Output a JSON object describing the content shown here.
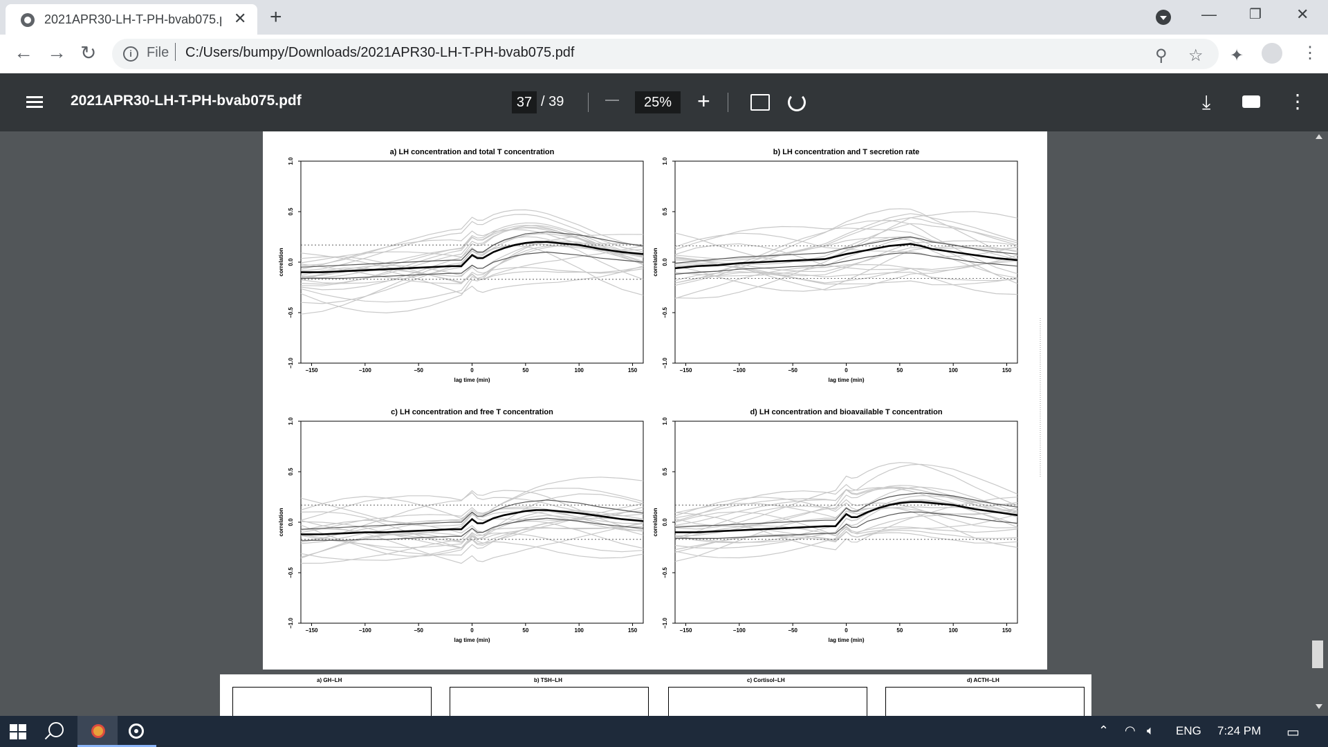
{
  "browser": {
    "tab_title": "2021APR30-LH-T-PH-bvab075.pdf",
    "new_tab": "+",
    "address_scheme": "File",
    "address_url": "C:/Users/bumpy/Downloads/2021APR30-LH-T-PH-bvab075.pdf"
  },
  "viewer": {
    "file_title": "2021APR30-LH-T-PH-bvab075.pdf",
    "current_page": "37",
    "total_pages": "/ 39",
    "zoom": "25%"
  },
  "taskbar": {
    "language": "ENG",
    "time": "7:24 PM"
  },
  "page38_titles": [
    "a) GH–LH",
    "b) TSH–LH",
    "c) Cortisol–LH",
    "d) ACTH–LH"
  ],
  "colors": {
    "thin_lines": "#c8c8c8",
    "mean_line": "#000000",
    "band_line": "#555555",
    "viewer_bg": "#525659",
    "toolbar_bg": "#323639"
  },
  "chart_data": [
    {
      "type": "line",
      "title": "a) LH concentration and total T concentration",
      "xlabel": "lag time (min)",
      "ylabel": "correlation",
      "x_ticks": [
        "−150",
        "−100",
        "−50",
        "0",
        "50",
        "100",
        "150"
      ],
      "y_ticks": [
        "−1.0",
        "−0.5",
        "0.0",
        "0.5",
        "1.0"
      ],
      "xlim": [
        -160,
        160
      ],
      "ylim": [
        -1,
        1
      ],
      "x": [
        -160,
        -140,
        -120,
        -100,
        -80,
        -60,
        -40,
        -20,
        -10,
        0,
        5,
        10,
        20,
        30,
        40,
        50,
        60,
        70,
        80,
        100,
        120,
        140,
        160
      ],
      "series": [
        {
          "role": "mean",
          "values": [
            -0.1,
            -0.1,
            -0.09,
            -0.08,
            -0.07,
            -0.06,
            -0.05,
            -0.04,
            -0.04,
            0.07,
            0.04,
            0.04,
            0.1,
            0.14,
            0.17,
            0.19,
            0.2,
            0.2,
            0.19,
            0.17,
            0.13,
            0.1,
            0.08
          ]
        },
        {
          "role": "band_low",
          "values": [
            -0.16,
            -0.16,
            -0.16,
            -0.15,
            -0.14,
            -0.13,
            -0.12,
            -0.11,
            -0.11,
            -0.03,
            -0.06,
            -0.06,
            0.0,
            0.03,
            0.06,
            0.08,
            0.09,
            0.1,
            0.09,
            0.07,
            0.04,
            0.02,
            0.0
          ]
        },
        {
          "role": "band_high",
          "values": [
            -0.05,
            -0.04,
            -0.03,
            -0.02,
            -0.01,
            0.0,
            0.01,
            0.02,
            0.02,
            0.13,
            0.1,
            0.1,
            0.17,
            0.22,
            0.25,
            0.28,
            0.29,
            0.3,
            0.29,
            0.27,
            0.23,
            0.19,
            0.16
          ]
        }
      ],
      "significance": [
        0.17,
        -0.17
      ]
    },
    {
      "type": "line",
      "title": "b) LH concentration and T secretion rate",
      "xlabel": "lag time (min)",
      "ylabel": "correlation",
      "x_ticks": [
        "−150",
        "−100",
        "−50",
        "0",
        "50",
        "100",
        "150"
      ],
      "y_ticks": [
        "−1.0",
        "−0.5",
        "0.0",
        "0.5",
        "1.0"
      ],
      "xlim": [
        -160,
        160
      ],
      "ylim": [
        -1,
        1
      ],
      "x": [
        -160,
        -140,
        -120,
        -100,
        -80,
        -60,
        -40,
        -20,
        0,
        20,
        40,
        50,
        60,
        70,
        80,
        100,
        120,
        140,
        160
      ],
      "series": [
        {
          "role": "mean",
          "values": [
            -0.06,
            -0.04,
            -0.03,
            -0.01,
            0.0,
            0.01,
            0.02,
            0.03,
            0.08,
            0.12,
            0.16,
            0.17,
            0.18,
            0.16,
            0.13,
            0.1,
            0.07,
            0.04,
            0.02
          ]
        },
        {
          "role": "band_low",
          "values": [
            -0.12,
            -0.1,
            -0.09,
            -0.07,
            -0.06,
            -0.05,
            -0.04,
            -0.03,
            0.01,
            0.05,
            0.08,
            0.09,
            0.09,
            0.08,
            0.06,
            0.03,
            0.0,
            -0.02,
            -0.04
          ]
        },
        {
          "role": "band_high",
          "values": [
            -0.01,
            0.01,
            0.03,
            0.05,
            0.06,
            0.07,
            0.08,
            0.09,
            0.14,
            0.18,
            0.22,
            0.24,
            0.25,
            0.23,
            0.2,
            0.17,
            0.13,
            0.1,
            0.08
          ]
        }
      ],
      "significance": [
        0.16,
        -0.16
      ]
    },
    {
      "type": "line",
      "title": "c) LH concentration and free T concentration",
      "xlabel": "lag time (min)",
      "ylabel": "correlation",
      "x_ticks": [
        "−150",
        "−100",
        "−50",
        "0",
        "50",
        "100",
        "150"
      ],
      "y_ticks": [
        "−1.0",
        "−0.5",
        "0.0",
        "0.5",
        "1.0"
      ],
      "xlim": [
        -160,
        160
      ],
      "ylim": [
        -1,
        1
      ],
      "x": [
        -160,
        -140,
        -120,
        -100,
        -80,
        -60,
        -40,
        -20,
        -10,
        0,
        5,
        10,
        20,
        30,
        40,
        50,
        60,
        70,
        80,
        100,
        120,
        140,
        160
      ],
      "series": [
        {
          "role": "mean",
          "values": [
            -0.12,
            -0.12,
            -0.11,
            -0.1,
            -0.1,
            -0.09,
            -0.08,
            -0.07,
            -0.07,
            0.03,
            -0.01,
            -0.01,
            0.04,
            0.07,
            0.09,
            0.11,
            0.12,
            0.12,
            0.11,
            0.09,
            0.06,
            0.03,
            0.01
          ]
        },
        {
          "role": "band_low",
          "values": [
            -0.18,
            -0.18,
            -0.18,
            -0.17,
            -0.17,
            -0.16,
            -0.15,
            -0.14,
            -0.14,
            -0.06,
            -0.1,
            -0.1,
            -0.05,
            -0.02,
            0.0,
            0.02,
            0.03,
            0.04,
            0.03,
            0.01,
            -0.02,
            -0.04,
            -0.06
          ]
        },
        {
          "role": "band_high",
          "values": [
            -0.07,
            -0.06,
            -0.05,
            -0.04,
            -0.03,
            -0.02,
            -0.01,
            0.0,
            0.0,
            0.1,
            0.06,
            0.06,
            0.11,
            0.15,
            0.18,
            0.2,
            0.21,
            0.22,
            0.21,
            0.19,
            0.15,
            0.12,
            0.09
          ]
        }
      ],
      "significance": [
        0.17,
        -0.17
      ]
    },
    {
      "type": "line",
      "title": "d) LH concentration and bioavailable T concentration",
      "xlabel": "lag time (min)",
      "ylabel": "correlation",
      "x_ticks": [
        "−150",
        "−100",
        "−50",
        "0",
        "50",
        "100",
        "150"
      ],
      "y_ticks": [
        "−1.0",
        "−0.5",
        "0.0",
        "0.5",
        "1.0"
      ],
      "xlim": [
        -160,
        160
      ],
      "ylim": [
        -1,
        1
      ],
      "x": [
        -160,
        -140,
        -120,
        -100,
        -80,
        -60,
        -40,
        -20,
        -10,
        0,
        5,
        10,
        20,
        30,
        40,
        50,
        60,
        70,
        80,
        100,
        120,
        140,
        160
      ],
      "series": [
        {
          "role": "mean",
          "values": [
            -0.1,
            -0.1,
            -0.09,
            -0.08,
            -0.07,
            -0.06,
            -0.05,
            -0.04,
            -0.04,
            0.08,
            0.05,
            0.05,
            0.1,
            0.14,
            0.17,
            0.19,
            0.2,
            0.2,
            0.19,
            0.17,
            0.13,
            0.1,
            0.07
          ]
        },
        {
          "role": "band_low",
          "values": [
            -0.16,
            -0.16,
            -0.16,
            -0.15,
            -0.14,
            -0.13,
            -0.12,
            -0.11,
            -0.11,
            -0.02,
            -0.05,
            -0.05,
            0.01,
            0.04,
            0.07,
            0.09,
            0.1,
            0.1,
            0.09,
            0.07,
            0.04,
            0.01,
            -0.01
          ]
        },
        {
          "role": "band_high",
          "values": [
            -0.05,
            -0.04,
            -0.03,
            -0.02,
            -0.01,
            0.0,
            0.01,
            0.02,
            0.02,
            0.14,
            0.11,
            0.11,
            0.17,
            0.22,
            0.25,
            0.27,
            0.28,
            0.29,
            0.28,
            0.26,
            0.22,
            0.18,
            0.15
          ]
        }
      ],
      "significance": [
        0.17,
        -0.17
      ]
    }
  ]
}
